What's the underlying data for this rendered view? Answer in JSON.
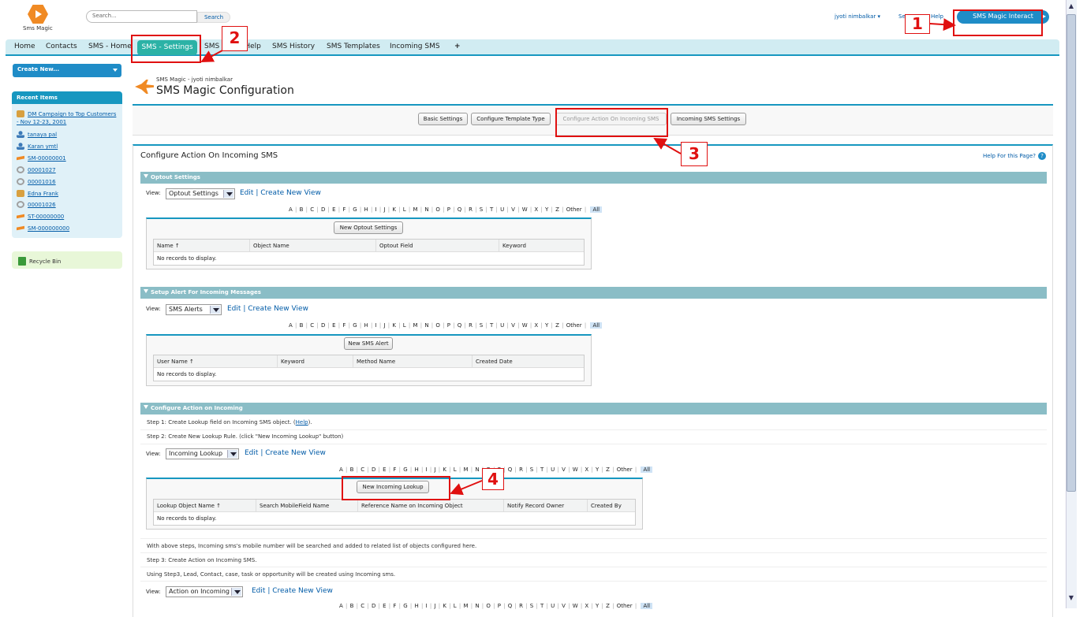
{
  "header": {
    "logo_text": "Sms Magic",
    "search_placeholder": "Search...",
    "search_button": "Search",
    "user": "jyoti nimbalkar",
    "setup": "Setup",
    "help": "Help",
    "app_menu": "SMS Magic Interact"
  },
  "tabs": [
    "Home",
    "Contacts",
    "SMS - Home",
    "SMS - Settings",
    "SMS Magic Help",
    "SMS History",
    "SMS Templates",
    "Incoming SMS",
    "+"
  ],
  "sidebar": {
    "create_new": "Create New...",
    "recent_title": "Recent Items",
    "recent_items": [
      {
        "label": "DM Campaign to Top Customers - Nov 12-23, 2001",
        "icon": "campaign-icon"
      },
      {
        "label": "tanaya pal",
        "icon": "user-icon"
      },
      {
        "label": "Karan ymtl",
        "icon": "user-icon"
      },
      {
        "label": "SM-00000001",
        "icon": "sms-icon"
      },
      {
        "label": "00001027",
        "icon": "case-icon"
      },
      {
        "label": "00001016",
        "icon": "case-icon"
      },
      {
        "label": "Edna Frank",
        "icon": "contact-icon"
      },
      {
        "label": "00001026",
        "icon": "case-icon"
      },
      {
        "label": "ST-00000000",
        "icon": "sms-icon"
      },
      {
        "label": "SM-000000000",
        "icon": "sms-icon"
      }
    ],
    "recycle_bin": "Recycle Bin"
  },
  "page": {
    "breadcrumb": "SMS Magic - jyoti nimbalkar",
    "title": "SMS Magic Configuration",
    "buttons": [
      "Basic Settings",
      "Configure Template Type",
      "Configure Action On Incoming SMS",
      "Incoming SMS Settings"
    ],
    "panel_title": "Configure Action On Incoming SMS",
    "help_link": "Help For this Page?",
    "help_q": "?"
  },
  "alpha": [
    "A",
    "B",
    "C",
    "D",
    "E",
    "F",
    "G",
    "H",
    "I",
    "J",
    "K",
    "L",
    "M",
    "N",
    "O",
    "P",
    "Q",
    "R",
    "S",
    "T",
    "U",
    "V",
    "W",
    "X",
    "Y",
    "Z",
    "Other"
  ],
  "alpha_all": "All",
  "common": {
    "view": "View:",
    "edit": "Edit",
    "sep": "|",
    "create_view": "Create New View",
    "no_records": "No records to display."
  },
  "optout": {
    "section": "Optout Settings",
    "view_value": "Optout Settings",
    "new_button": "New Optout Settings",
    "columns": [
      "Name ↑",
      "Object Name",
      "Optout Field",
      "Keyword"
    ]
  },
  "alerts": {
    "section": "Setup Alert For Incoming Messages",
    "view_value": "SMS Alerts",
    "new_button": "New SMS Alert",
    "columns": [
      "User Name ↑",
      "Keyword",
      "Method Name",
      "Created Date"
    ]
  },
  "action": {
    "section": "Configure Action on Incoming",
    "step1_pre": "Step 1: Create Lookup field on Incoming SMS object. (",
    "step1_link": "Help",
    "step1_post": ").",
    "step2": "Step 2: Create New Lookup Rule. (click \"New Incoming Lookup\" button)",
    "view_value": "Incoming Lookup",
    "new_button": "New Incoming Lookup",
    "columns": [
      "Lookup Object Name ↑",
      "Search MobileField Name",
      "Reference Name on Incoming Object",
      "Notify Record Owner",
      "Created By"
    ],
    "note1": "With above steps, Incoming sms's mobile number will be searched and added to related list of objects configured here.",
    "step3": "Step 3: Create Action on Incoming SMS.",
    "note2": "Using Step3, Lead, Contact, case, task or opportunity will be created using Incoming sms.",
    "view2_value": "Action on Incoming"
  },
  "annotations": [
    "1",
    "2",
    "3",
    "4"
  ],
  "colors": {
    "accent": "#1797c0",
    "section": "#8abdc6",
    "tab_active": "#2bb2a6",
    "annotation": "#e01010",
    "link": "#015ba7"
  }
}
